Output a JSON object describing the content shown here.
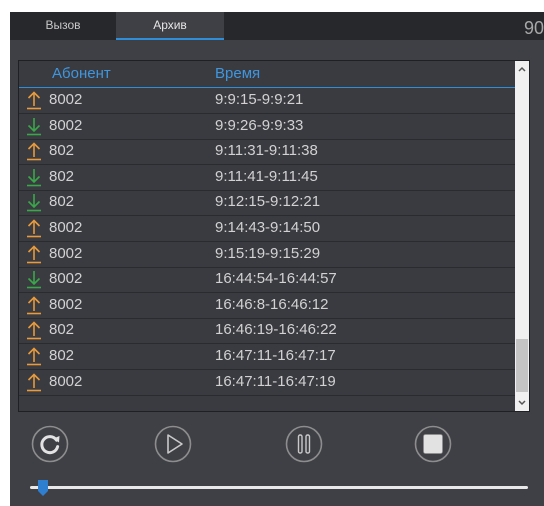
{
  "tabs": [
    {
      "label": "Вызов"
    },
    {
      "label": "Архив"
    }
  ],
  "corner_number": "90",
  "table": {
    "headers": {
      "subscriber": "Абонент",
      "time": "Время"
    },
    "rows": [
      {
        "direction": "outgoing",
        "subscriber": "8002",
        "time": "9:9:15-9:9:21"
      },
      {
        "direction": "incoming",
        "subscriber": "8002",
        "time": "9:9:26-9:9:33"
      },
      {
        "direction": "outgoing",
        "subscriber": "802",
        "time": "9:11:31-9:11:38"
      },
      {
        "direction": "incoming",
        "subscriber": "802",
        "time": "9:11:41-9:11:45"
      },
      {
        "direction": "incoming",
        "subscriber": "802",
        "time": "9:12:15-9:12:21"
      },
      {
        "direction": "outgoing",
        "subscriber": "8002",
        "time": "9:14:43-9:14:50"
      },
      {
        "direction": "outgoing",
        "subscriber": "8002",
        "time": "9:15:19-9:15:29"
      },
      {
        "direction": "incoming",
        "subscriber": "8002",
        "time": "16:44:54-16:44:57"
      },
      {
        "direction": "outgoing",
        "subscriber": "8002",
        "time": "16:46:8-16:46:12"
      },
      {
        "direction": "outgoing",
        "subscriber": "802",
        "time": "16:46:19-16:46:22"
      },
      {
        "direction": "outgoing",
        "subscriber": "802",
        "time": "16:47:11-16:47:17"
      },
      {
        "direction": "outgoing",
        "subscriber": "8002",
        "time": "16:47:11-16:47:19"
      }
    ]
  },
  "controls": [
    "refresh-icon",
    "play-icon",
    "pause-icon",
    "stop-icon"
  ],
  "playback_progress": 0,
  "colors": {
    "accent": "#2e8fd8",
    "outgoing": "#e89a3c",
    "incoming": "#3aa84a"
  }
}
